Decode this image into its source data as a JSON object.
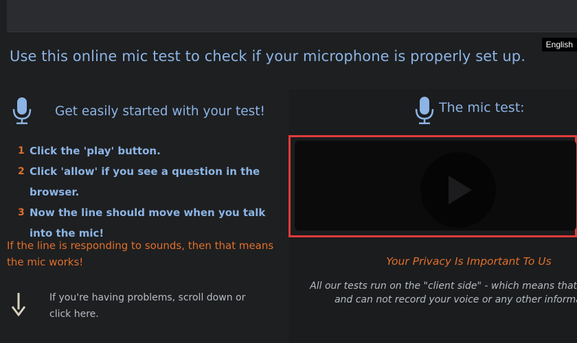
{
  "header": {
    "language": "English",
    "headline": "Use this online mic test to check if your microphone is properly set up."
  },
  "instructions": {
    "title": "Get easily started with your test!",
    "steps": [
      {
        "number": "1",
        "text": "Click the 'play' button."
      },
      {
        "number": "2",
        "text": "Click 'allow' if you see a question in the browser."
      },
      {
        "number": "3",
        "text": "Now the line should move when you talk into the mic!"
      }
    ],
    "works_note": "If the line is responding to sounds, then that means the mic works!",
    "help_note": "If you're having problems, scroll down or click here."
  },
  "mic_test": {
    "title": "The mic test:",
    "privacy_title": "Your Privacy Is Important To Us",
    "privacy_text": "All our tests run on the \"client side\" - which means that we do not and can not record your voice or any other information."
  },
  "colors": {
    "background": "#1e1f21",
    "accent_blue": "#8cb4e4",
    "accent_orange": "#e0702a",
    "highlight_red": "#e03b3b"
  },
  "icons": [
    "microphone-icon",
    "down-arrow-icon",
    "play-icon"
  ]
}
